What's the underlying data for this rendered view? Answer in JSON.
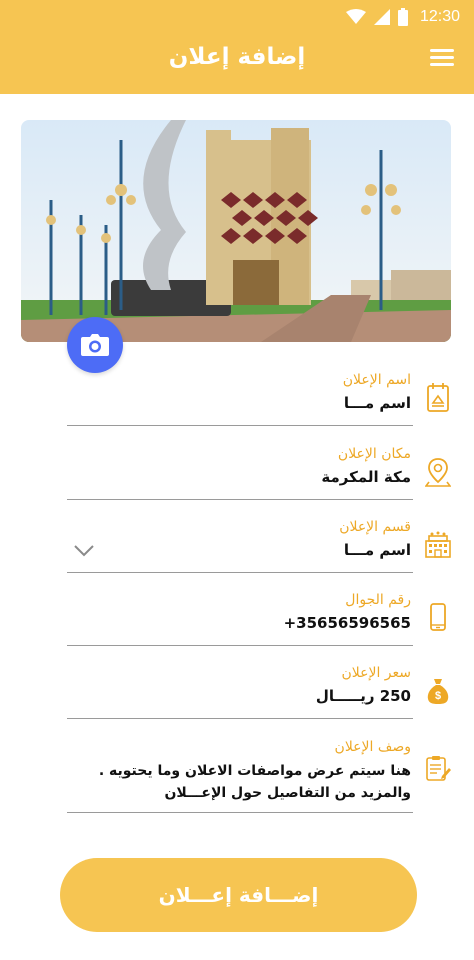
{
  "status_bar": {
    "time": "12:30"
  },
  "app_bar": {
    "title": "إضافة إعلان"
  },
  "form": {
    "name": {
      "label": "اسم الإعلان",
      "value": "اسم مـــا"
    },
    "location": {
      "label": "مكان الإعلان",
      "value": "مكة المكرمة"
    },
    "category": {
      "label": "قسم الإعلان",
      "value": "اسم مـــا"
    },
    "phone": {
      "label": "رقم الجوال",
      "value": "+35656596565"
    },
    "price": {
      "label": "سعر الإعلان",
      "value": "250 ريـــــال"
    },
    "description": {
      "label": "وصف الإعلان",
      "value": "هنا سيتم عرض مواصفات الاعلان وما يحتويه . والمزيد من التفاصيل حول الإعـــلان"
    }
  },
  "submit_label": "إضـــافة إعـــلان",
  "colors": {
    "accent": "#F6C552",
    "label": "#EDA826",
    "camera": "#4D6CF6"
  },
  "icons": {
    "status": [
      "wifi-icon",
      "signal-icon",
      "battery-icon"
    ],
    "menu": "menu-icon",
    "camera": "camera-icon",
    "name": "calendar-icon",
    "location": "location-pin-icon",
    "category": "building-icon",
    "phone": "phone-icon",
    "price": "money-bag-icon",
    "description": "document-edit-icon",
    "dropdown": "chevron-down-icon"
  }
}
